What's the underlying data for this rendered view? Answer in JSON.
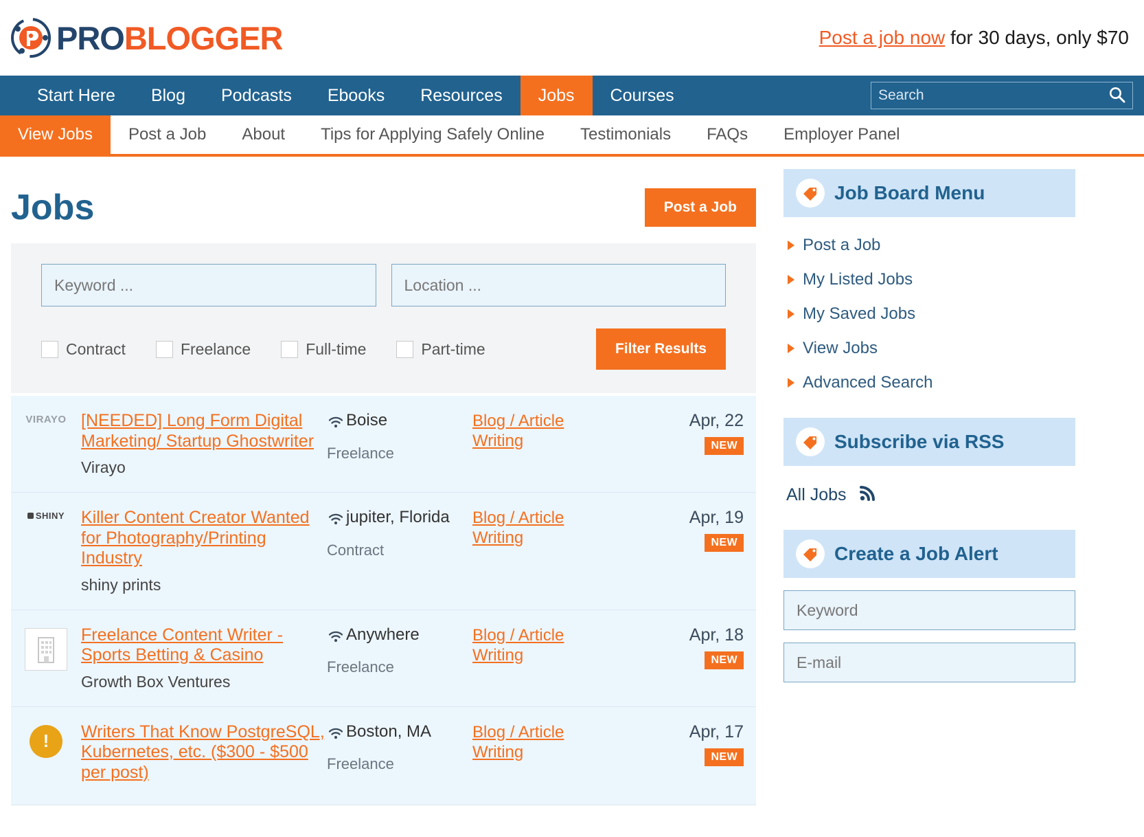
{
  "header": {
    "logo_pro": "PRO",
    "logo_blogger": "BLOGGER",
    "promo_link": "Post a job now",
    "promo_rest": " for 30 days, only $70"
  },
  "mainnav": {
    "items": [
      {
        "label": "Start Here",
        "active": false
      },
      {
        "label": "Blog",
        "active": false
      },
      {
        "label": "Podcasts",
        "active": false
      },
      {
        "label": "Ebooks",
        "active": false
      },
      {
        "label": "Resources",
        "active": false
      },
      {
        "label": "Jobs",
        "active": true
      },
      {
        "label": "Courses",
        "active": false
      }
    ],
    "search_placeholder": "Search",
    "search_value": ""
  },
  "subnav": {
    "items": [
      {
        "label": "View Jobs",
        "active": true
      },
      {
        "label": "Post a Job",
        "active": false
      },
      {
        "label": "About",
        "active": false
      },
      {
        "label": "Tips for Applying Safely Online",
        "active": false
      },
      {
        "label": "Testimonials",
        "active": false
      },
      {
        "label": "FAQs",
        "active": false
      },
      {
        "label": "Employer Panel",
        "active": false
      }
    ]
  },
  "main": {
    "title": "Jobs",
    "post_job_button": "Post a Job",
    "filters": {
      "keyword_placeholder": "Keyword ...",
      "keyword_value": "",
      "location_placeholder": "Location ...",
      "location_value": "",
      "checkboxes": [
        {
          "label": "Contract",
          "checked": false
        },
        {
          "label": "Freelance",
          "checked": false
        },
        {
          "label": "Full-time",
          "checked": false
        },
        {
          "label": "Part-time",
          "checked": false
        }
      ],
      "filter_button": "Filter Results"
    },
    "jobs": [
      {
        "logo_kind": "virayo",
        "logo_text": "VIRAYO",
        "title": "[NEEDED] Long Form Digital Marketing/ Startup Ghostwriter",
        "company": "Virayo",
        "location": "Boise",
        "type": "Freelance",
        "category": "Blog / Article Writing",
        "date": "Apr, 22",
        "badge": "NEW"
      },
      {
        "logo_kind": "shiny",
        "logo_text": "SHINY",
        "title": "Killer Content Creator Wanted for Photography/Printing Industry",
        "company": "shiny prints",
        "location": "jupiter, Florida",
        "type": "Contract",
        "category": "Blog / Article Writing",
        "date": "Apr, 19",
        "badge": "NEW"
      },
      {
        "logo_kind": "building",
        "logo_text": "",
        "title": "Freelance Content Writer - Sports Betting & Casino",
        "company": "Growth Box Ventures",
        "location": "Anywhere",
        "type": "Freelance",
        "category": "Blog / Article Writing",
        "date": "Apr, 18",
        "badge": "NEW"
      },
      {
        "logo_kind": "circle",
        "logo_text": "!",
        "title": "Writers That Know PostgreSQL, Kubernetes, etc. ($300 - $500 per post)",
        "company": "",
        "location": "Boston, MA",
        "type": "Freelance",
        "category": "Blog / Article Writing",
        "date": "Apr, 17",
        "badge": "NEW"
      }
    ]
  },
  "sidebar": {
    "menu_title": "Job Board Menu",
    "menu_items": [
      {
        "label": "Post a Job"
      },
      {
        "label": "My Listed Jobs"
      },
      {
        "label": "My Saved Jobs"
      },
      {
        "label": "View Jobs"
      },
      {
        "label": "Advanced Search"
      }
    ],
    "rss_title": "Subscribe via RSS",
    "rss_label": "All Jobs",
    "alert_title": "Create a Job Alert",
    "alert_keyword_placeholder": "Keyword",
    "alert_keyword_value": "",
    "alert_email_placeholder": "E-mail",
    "alert_email_value": ""
  },
  "colors": {
    "brand_orange": "#f4701f",
    "brand_blue": "#21628f",
    "row_bg": "#ecf6fd",
    "panel_blue": "#cfe4f7"
  }
}
